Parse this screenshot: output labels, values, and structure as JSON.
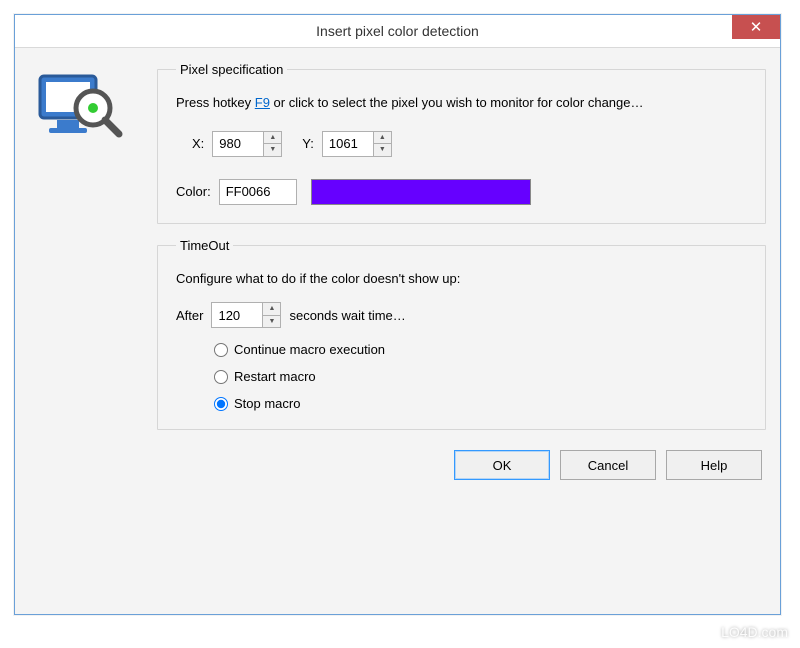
{
  "window": {
    "title": "Insert pixel color detection",
    "close_glyph": "✕"
  },
  "pixel_spec": {
    "legend": "Pixel specification",
    "instruction_pre": "Press hotkey ",
    "hotkey": "F9",
    "instruction_post": " or click to select the pixel you wish to monitor for color change…",
    "x_label": "X:",
    "x_value": "980",
    "y_label": "Y:",
    "y_value": "1061",
    "color_label": "Color:",
    "color_value": "FF0066",
    "swatch_color": "#6600ff"
  },
  "timeout": {
    "legend": "TimeOut",
    "instruction": "Configure what to do if the color doesn't show up:",
    "after_label": "After",
    "after_value": "120",
    "after_suffix": "seconds wait time…",
    "options": {
      "continue": "Continue macro execution",
      "restart": "Restart macro",
      "stop": "Stop macro"
    },
    "selected": "stop"
  },
  "buttons": {
    "ok": "OK",
    "cancel": "Cancel",
    "help": "Help"
  },
  "watermark": "LO4D.com"
}
